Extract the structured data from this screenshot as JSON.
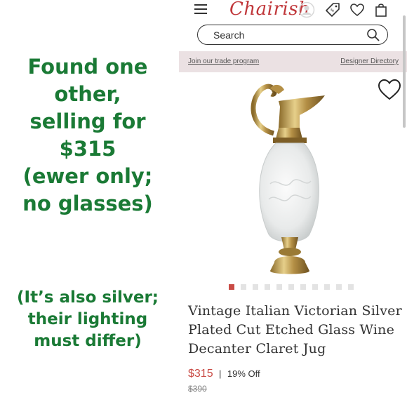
{
  "annotation": {
    "main_lines": [
      "Found one",
      "other,",
      "selling for",
      "$315",
      "(ewer only;",
      "no glasses)"
    ],
    "note_lines": [
      "(It’s also silver;",
      "their lighting",
      "must differ)"
    ]
  },
  "header": {
    "logo": "Chairish",
    "search": {
      "placeholder": "Search"
    }
  },
  "tradebar": {
    "trade_link": "Join our trade program",
    "designer_link": "Designer Directory"
  },
  "product": {
    "title": "Vintage Italian Victorian Silver Plated Cut Etched Glass Wine Decanter Claret Jug",
    "price": "$315",
    "separator": "|",
    "discount": "19% Off",
    "old_price": "$390",
    "carousel": {
      "total": 11,
      "active_index": 0
    }
  },
  "colors": {
    "annotation_green": "#1a7a35",
    "brand_red": "#c0373a",
    "price_red": "#c94b45",
    "tradebar_bg": "#ebe1e3"
  },
  "icons": [
    "menu-icon",
    "user-icon",
    "price-tag-icon",
    "heart-icon",
    "shopping-bag-icon",
    "search-icon",
    "favorite-heart-icon"
  ]
}
